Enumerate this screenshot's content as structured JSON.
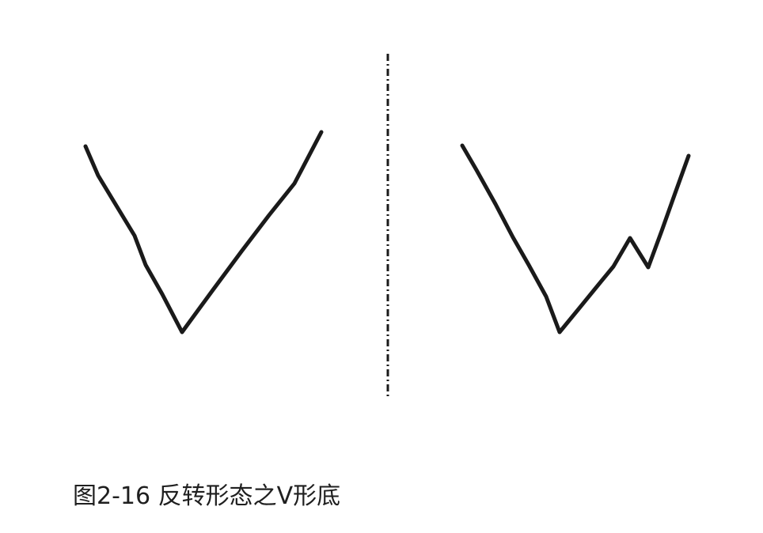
{
  "figure": {
    "caption": "图2-16 反转形态之V形底",
    "colors": {
      "stroke": "#1a1a1a",
      "background": "#ffffff"
    }
  }
}
